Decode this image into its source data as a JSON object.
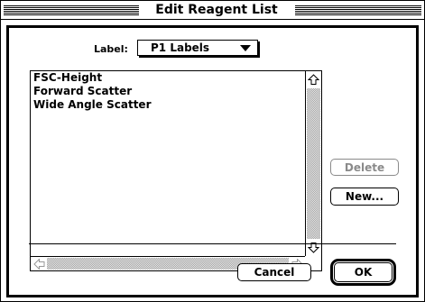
{
  "window": {
    "title": "Edit Reagent List"
  },
  "label_popup": {
    "label": "Label:",
    "value": "P1 Labels"
  },
  "reagent_list": {
    "items": [
      "FSC-Height",
      "Forward Scatter",
      "Wide Angle Scatter"
    ]
  },
  "buttons": {
    "delete": "Delete",
    "new": "New...",
    "cancel": "Cancel",
    "ok": "OK"
  },
  "icons": {
    "scroll_up": "arrow-up-icon",
    "scroll_down": "arrow-down-icon",
    "scroll_left": "arrow-left-icon",
    "scroll_right": "arrow-right-icon",
    "popup": "triangle-down-icon"
  }
}
